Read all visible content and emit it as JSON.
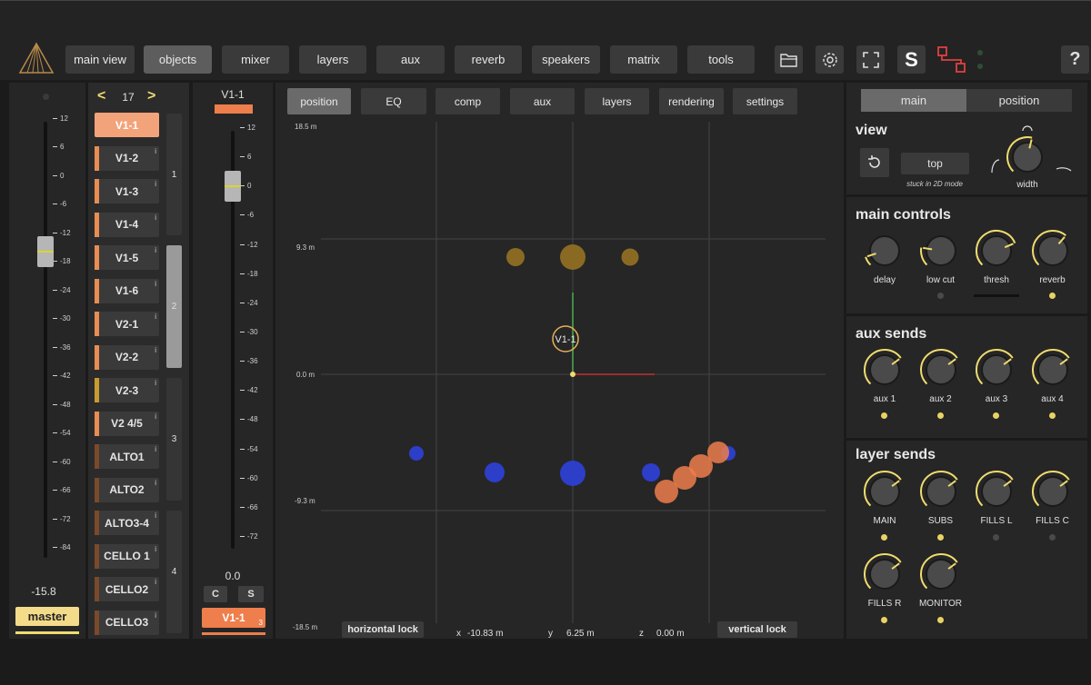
{
  "nav": {
    "items": [
      "main view",
      "objects",
      "mixer",
      "layers",
      "aux",
      "reverb",
      "speakers",
      "matrix",
      "tools"
    ],
    "active": "objects",
    "solo_label": "S",
    "help_label": "?"
  },
  "master": {
    "value": "-15.8",
    "label": "master",
    "ticks": [
      "12",
      "6",
      "0",
      "-6",
      "-12",
      "-18",
      "-24",
      "-30",
      "-36",
      "-42",
      "-48",
      "-54",
      "-60",
      "-66",
      "-72",
      "-84"
    ],
    "fader_db": -15.8
  },
  "objects": {
    "page": "17",
    "prev": "<",
    "next": ">",
    "items": [
      {
        "label": "V1-1",
        "color": "#f3a37a",
        "selected": true
      },
      {
        "label": "V1-2",
        "color": "#e98d52"
      },
      {
        "label": "V1-3",
        "color": "#e98d52"
      },
      {
        "label": "V1-4",
        "color": "#e98d52"
      },
      {
        "label": "V1-5",
        "color": "#e98d52"
      },
      {
        "label": "V1-6",
        "color": "#e98d52"
      },
      {
        "label": "V2-1",
        "color": "#e98d52"
      },
      {
        "label": "V2-2",
        "color": "#e98d52"
      },
      {
        "label": "V2-3",
        "color": "#c99a2e"
      },
      {
        "label": "V2 4/5",
        "color": "#e98d52"
      },
      {
        "label": "ALTO1",
        "color": "#7a4a2a"
      },
      {
        "label": "ALTO2",
        "color": "#7a4a2a"
      },
      {
        "label": "ALTO3-4",
        "color": "#7a4a2a"
      },
      {
        "label": "CELLO 1",
        "color": "#7a4a2a"
      },
      {
        "label": "CELLO2",
        "color": "#7a4a2a"
      },
      {
        "label": "CELLO3",
        "color": "#7a4a2a"
      }
    ],
    "info": "i",
    "groups": [
      "1",
      "2",
      "3",
      "4"
    ]
  },
  "channel": {
    "name": "V1-1",
    "value": "0.0",
    "c_label": "C",
    "s_label": "S",
    "bottom_label": "V1-1",
    "bottom_num": "3",
    "ticks": [
      "12",
      "6",
      "0",
      "-6",
      "-12",
      "-18",
      "-24",
      "-30",
      "-36",
      "-42",
      "-48",
      "-54",
      "-60",
      "-66",
      "-72"
    ],
    "fader_db": 0.0
  },
  "tabs": {
    "items": [
      "position",
      "EQ",
      "comp",
      "aux",
      "layers",
      "rendering",
      "settings"
    ],
    "active": "position"
  },
  "position_view": {
    "y_labels": [
      "18.5 m",
      "9.3 m",
      "0.0 m",
      "-9.3 m",
      "-18.5 m"
    ],
    "selected_label": "V1-1",
    "horizontal_lock": "horizontal lock",
    "vertical_lock": "vertical lock",
    "x_label": "x",
    "x_value": "-10.83 m",
    "y_label": "y",
    "y_value": "6.25 m",
    "z_label": "z",
    "z_value": "0.00 m"
  },
  "right_panel": {
    "tabs": [
      "main",
      "position"
    ],
    "active_tab": "main",
    "view": {
      "title": "view",
      "mode": "top",
      "note": "stuck in 2D mode",
      "width_label": "width"
    },
    "main_controls": {
      "title": "main controls",
      "knobs": [
        {
          "label": "delay",
          "value": 0.1,
          "indicator": "none"
        },
        {
          "label": "low cut",
          "value": 0.2,
          "indicator": "off"
        },
        {
          "label": "thresh",
          "value": 0.75,
          "indicator": "bar"
        },
        {
          "label": "reverb",
          "value": 0.65,
          "indicator": "on"
        }
      ]
    },
    "aux_sends": {
      "title": "aux sends",
      "knobs": [
        {
          "label": "aux 1",
          "value": 0.7,
          "indicator": "on"
        },
        {
          "label": "aux 2",
          "value": 0.7,
          "indicator": "on"
        },
        {
          "label": "aux 3",
          "value": 0.7,
          "indicator": "on"
        },
        {
          "label": "aux 4",
          "value": 0.7,
          "indicator": "on"
        }
      ]
    },
    "layer_sends": {
      "title": "layer sends",
      "knobs": [
        {
          "label": "MAIN",
          "value": 0.7,
          "indicator": "on"
        },
        {
          "label": "SUBS",
          "value": 0.7,
          "indicator": "on"
        },
        {
          "label": "FILLS L",
          "value": 0.7,
          "indicator": "off"
        },
        {
          "label": "FILLS C",
          "value": 0.7,
          "indicator": "off"
        },
        {
          "label": "FILLS R",
          "value": 0.7,
          "indicator": "on"
        },
        {
          "label": "MONITOR",
          "value": 0.7,
          "indicator": "on"
        }
      ]
    }
  },
  "colors": {
    "accent": "#f0dc6e",
    "object_orange": "#ee7e4c",
    "object_gold": "#8a6a22",
    "object_blue": "#2d3ec9"
  }
}
